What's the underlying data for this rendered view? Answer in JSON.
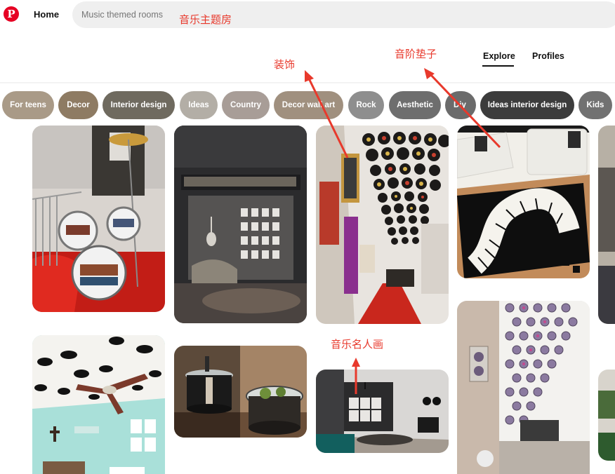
{
  "header": {
    "logo_letter": "P",
    "home_label": "Home",
    "search": {
      "placeholder": "Music themed rooms",
      "value": ""
    }
  },
  "annotations": {
    "search_note": "音乐主题房",
    "decor_note": "装饰",
    "mat_note": "音阶垫子",
    "portrait_note": "音乐名人画",
    "color": "#e8392c"
  },
  "tabs": {
    "explore": "Explore",
    "profiles": "Profiles",
    "active": "Explore"
  },
  "chips": [
    {
      "label": "For teens",
      "color": "#a99a87"
    },
    {
      "label": "Decor",
      "color": "#8e7b63"
    },
    {
      "label": "Interior design",
      "color": "#6f6a5f"
    },
    {
      "label": "Ideas",
      "color": "#b3aea6"
    },
    {
      "label": "Country",
      "color": "#a89d97"
    },
    {
      "label": "Decor wall art",
      "color": "#a0907f"
    },
    {
      "label": "Rock",
      "color": "#8e8e8e"
    },
    {
      "label": "Aesthetic",
      "color": "#6e6e6e"
    },
    {
      "label": "Diy",
      "color": "#6b6b6b"
    },
    {
      "label": "Ideas interior design",
      "color": "#3c3c3c"
    },
    {
      "label": "Kids",
      "color": "#717171"
    }
  ],
  "pins": [
    {
      "name": "pin-drum-bookshelf",
      "scene": "drum kit bookshelf with cymbal lamp"
    },
    {
      "name": "pin-dark-music-lounge",
      "scene": "dark lounge with guitar and framed pictures"
    },
    {
      "name": "pin-vinyl-record-hallway",
      "scene": "hallway ceiling covered with vinyl records"
    },
    {
      "name": "pin-piano-key-rug",
      "scene": "living room with piano keyboard rug"
    },
    {
      "name": "pin-vinyl-ceiling-nursery",
      "scene": "mint bedroom with vinyl records on ceiling and fan"
    },
    {
      "name": "pin-drum-tables",
      "scene": "bass drum side tables"
    },
    {
      "name": "pin-portrait-wall-room",
      "scene": "room with framed musician portraits"
    },
    {
      "name": "pin-cd-curtain",
      "scene": "CD curtain hanging by window"
    }
  ]
}
